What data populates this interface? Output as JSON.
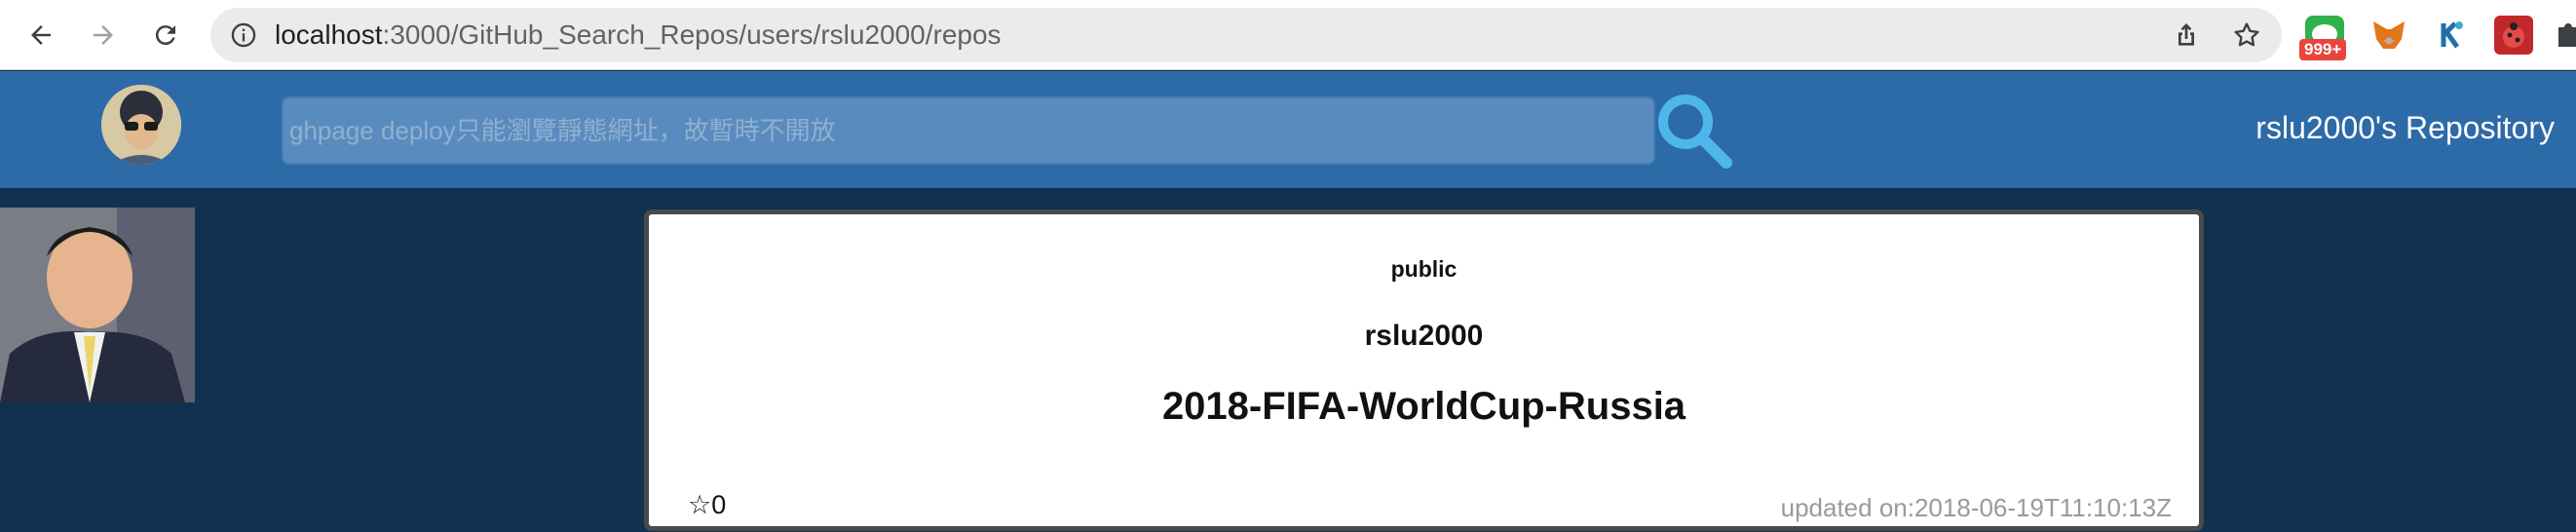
{
  "browser": {
    "url_host": "localhost",
    "url_path": ":3000/GitHub_Search_Repos/users/rslu2000/repos",
    "extension_badge": "999+",
    "icons": [
      "back-arrow-icon",
      "forward-arrow-icon",
      "reload-icon",
      "site-info-icon",
      "share-icon",
      "bookmark-star-icon"
    ]
  },
  "header": {
    "search_placeholder": "ghpage deploy只能瀏覽靜態網址，故暫時不開放",
    "title": "rslu2000's Repository",
    "accent_color": "#2d6aa8",
    "search_icon_color": "#4fb6ec"
  },
  "repo": {
    "visibility": "public",
    "owner": "rslu2000",
    "name": "2018-FIFA-WorldCup-Russia",
    "stars": "☆0",
    "updated": "updated on:2018-06-19T11:10:13Z"
  }
}
